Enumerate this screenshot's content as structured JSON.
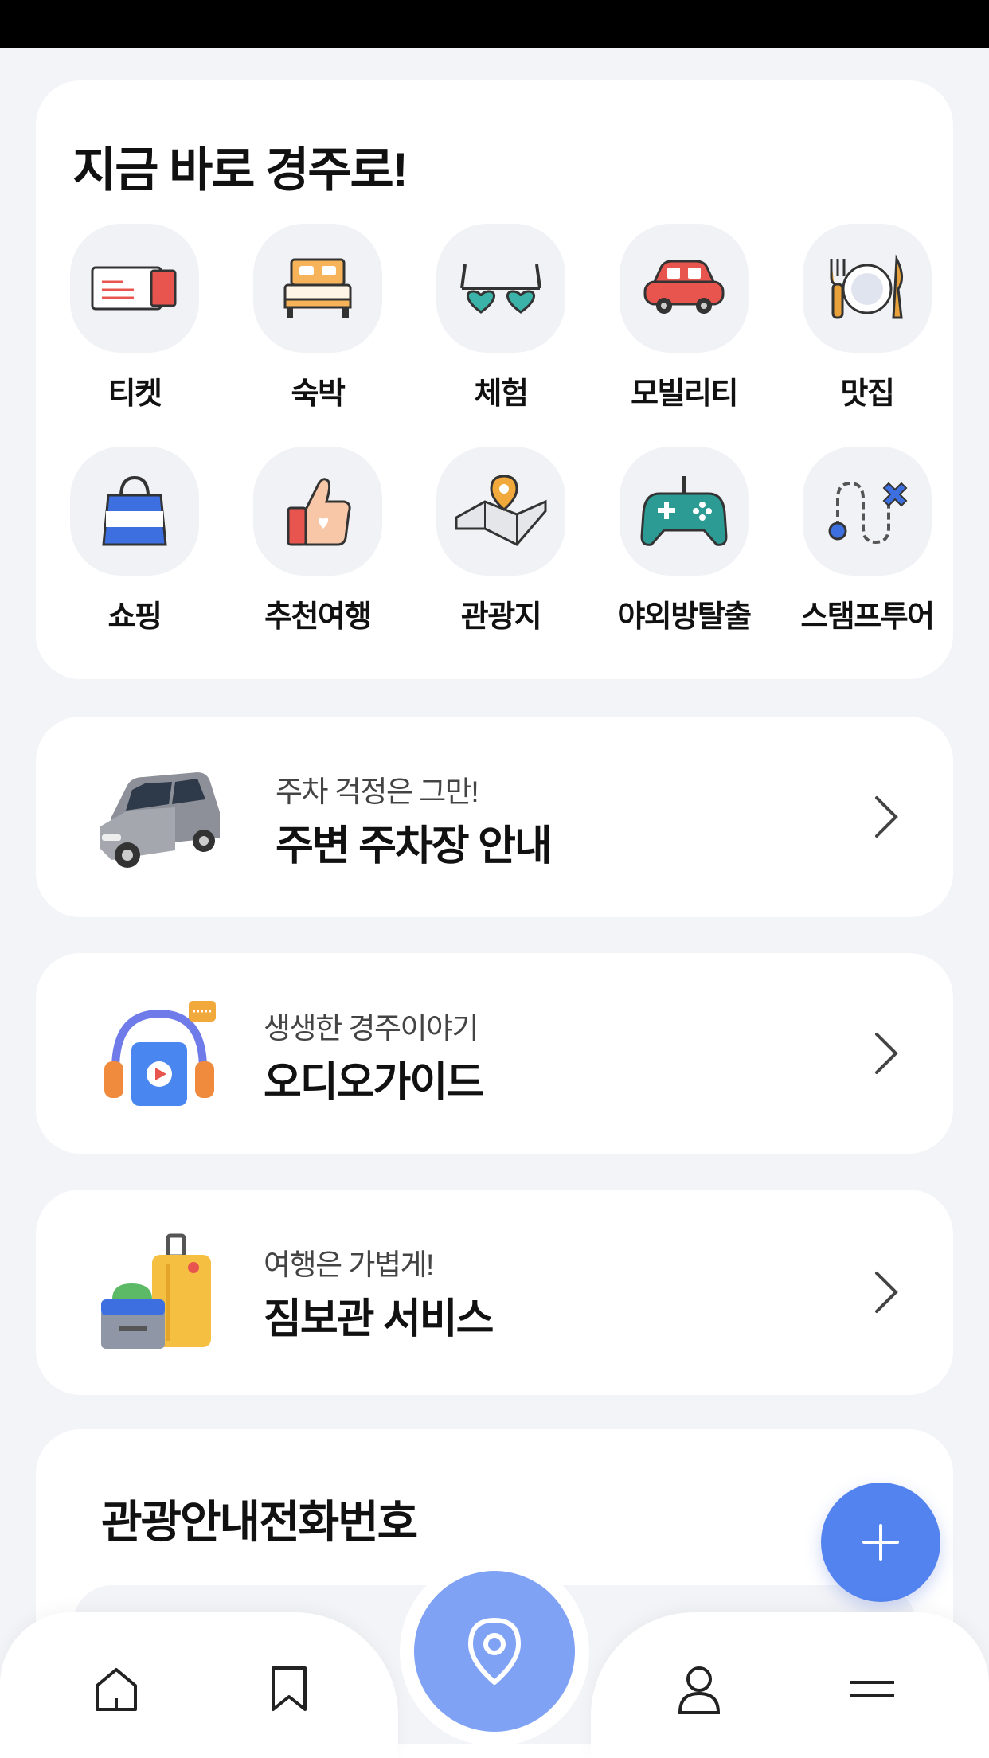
{
  "quick_menu": {
    "title": "지금 바로 경주로!",
    "items": [
      {
        "label": "티켓",
        "icon": "ticket-icon"
      },
      {
        "label": "숙박",
        "icon": "bed-icon"
      },
      {
        "label": "체험",
        "icon": "heart-glasses-icon"
      },
      {
        "label": "모빌리티",
        "icon": "car-icon"
      },
      {
        "label": "맛집",
        "icon": "dish-icon"
      },
      {
        "label": "쇼핑",
        "icon": "shopping-bag-icon"
      },
      {
        "label": "추천여행",
        "icon": "thumbs-up-icon"
      },
      {
        "label": "관광지",
        "icon": "map-pin-icon"
      },
      {
        "label": "야외방탈출",
        "icon": "gamepad-icon"
      },
      {
        "label": "스탬프투어",
        "icon": "route-icon"
      }
    ]
  },
  "promos": [
    {
      "subtitle": "주차 걱정은 그만!",
      "title": "주변 주차장 안내",
      "icon": "suv-car-icon"
    },
    {
      "subtitle": "생생한 경주이야기",
      "title": "오디오가이드",
      "icon": "headphones-icon"
    },
    {
      "subtitle": "여행은 가볍게!",
      "title": "짐보관 서비스",
      "icon": "luggage-icon"
    }
  ],
  "phone_section": {
    "title": "관광안내전화번호"
  },
  "colors": {
    "accent": "#5383ee",
    "center_button": "#7fa2f5",
    "background": "#f3f4f7"
  },
  "nav": [
    "home-icon",
    "bookmark-icon",
    "location-icon",
    "profile-icon",
    "menu-icon"
  ]
}
